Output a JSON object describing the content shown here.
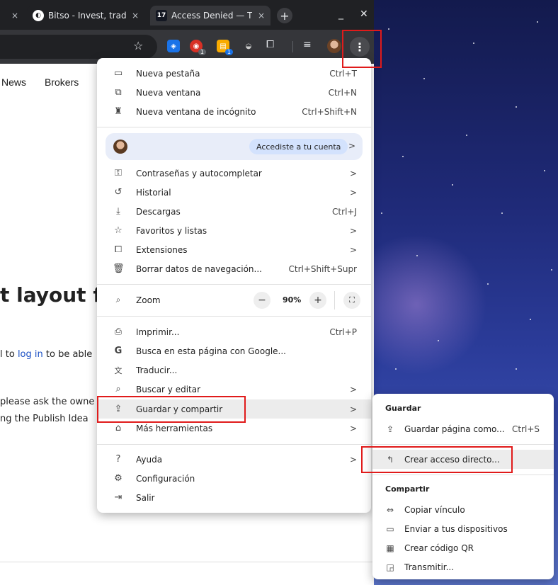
{
  "tabs": [
    {
      "title": "",
      "close": "×",
      "active": false
    },
    {
      "title": "Bitso - Invest, trade",
      "close": "×",
      "active": false
    },
    {
      "title": "Access Denied — T",
      "close": "×",
      "active": true,
      "favicon": "17"
    }
  ],
  "window": {
    "new_tab": "+",
    "minimize": "_",
    "close": "✕"
  },
  "toolbar": {
    "bookmark_icon": "star-icon",
    "extension_badges": [
      "1",
      "1"
    ],
    "menu_icon": "⋮"
  },
  "page": {
    "nav": [
      "News",
      "Brokers"
    ],
    "heading": "t layout fo",
    "line1_prefix": "l to ",
    "line1_link": "log in",
    "line1_suffix": " to be able",
    "line2": "please ask the owne",
    "line3": "ng the Publish Idea"
  },
  "menu": {
    "group1": [
      {
        "icon": "new-tab-icon",
        "glyph": "▭",
        "label": "Nueva pestaña",
        "shortcut": "Ctrl+T"
      },
      {
        "icon": "new-window-icon",
        "glyph": "⧉",
        "label": "Nueva ventana",
        "shortcut": "Ctrl+N"
      },
      {
        "icon": "incognito-icon",
        "glyph": "♜",
        "label": "Nueva ventana de incógnito",
        "shortcut": "Ctrl+Shift+N"
      }
    ],
    "profile": {
      "pill": "Accediste a tu cuenta",
      "chevron": ">"
    },
    "group2": [
      {
        "icon": "key-icon",
        "glyph": "⚿",
        "label": "Contraseñas y autocompletar",
        "shortcut": ">"
      },
      {
        "icon": "history-icon",
        "glyph": "↺",
        "label": "Historial",
        "shortcut": ">"
      },
      {
        "icon": "download-icon",
        "glyph": "⤓",
        "label": "Descargas",
        "shortcut": "Ctrl+J"
      },
      {
        "icon": "star-icon",
        "glyph": "☆",
        "label": "Favoritos y listas",
        "shortcut": ">"
      },
      {
        "icon": "puzzle-icon",
        "glyph": "⧠",
        "label": "Extensiones",
        "shortcut": ">"
      },
      {
        "icon": "trash-icon",
        "glyph": "🗑",
        "label": "Borrar datos de navegación...",
        "shortcut": "Ctrl+Shift+Supr"
      }
    ],
    "zoom": {
      "icon_glyph": "⌕",
      "label": "Zoom",
      "minus": "−",
      "value": "90%",
      "plus": "+",
      "fullscreen": "⛶"
    },
    "group3": [
      {
        "icon": "print-icon",
        "glyph": "⎙",
        "label": "Imprimir...",
        "shortcut": "Ctrl+P"
      },
      {
        "icon": "google-icon",
        "glyph": "G",
        "label": "Busca en esta página con Google...",
        "shortcut": ""
      },
      {
        "icon": "translate-icon",
        "glyph": "文",
        "label": "Traducir...",
        "shortcut": ""
      },
      {
        "icon": "find-edit-icon",
        "glyph": "⌕",
        "label": "Buscar y editar",
        "shortcut": ">"
      },
      {
        "icon": "save-share-icon",
        "glyph": "⇪",
        "label": "Guardar y compartir",
        "shortcut": ">"
      },
      {
        "icon": "toolbox-icon",
        "glyph": "⌂",
        "label": "Más herramientas",
        "shortcut": ">"
      }
    ],
    "group4": [
      {
        "icon": "help-icon",
        "glyph": "?",
        "label": "Ayuda",
        "shortcut": ">"
      },
      {
        "icon": "settings-icon",
        "glyph": "⚙",
        "label": "Configuración",
        "shortcut": ""
      },
      {
        "icon": "exit-icon",
        "glyph": "⇥",
        "label": "Salir",
        "shortcut": ""
      }
    ]
  },
  "submenu": {
    "save_heading": "Guardar",
    "save_items": [
      {
        "icon": "save-page-icon",
        "glyph": "⇪",
        "label": "Guardar página como...",
        "shortcut": "Ctrl+S"
      },
      {
        "icon": "shortcut-icon",
        "glyph": "↰",
        "label": "Crear acceso directo...",
        "shortcut": ""
      }
    ],
    "share_heading": "Compartir",
    "share_items": [
      {
        "icon": "link-icon",
        "glyph": "⇔",
        "label": "Copiar vínculo"
      },
      {
        "icon": "devices-icon",
        "glyph": "▭",
        "label": "Enviar a tus dispositivos"
      },
      {
        "icon": "qr-icon",
        "glyph": "▦",
        "label": "Crear código QR"
      },
      {
        "icon": "cast-icon",
        "glyph": "◲",
        "label": "Transmitir..."
      }
    ]
  },
  "annotation_color": "#e01b1b"
}
